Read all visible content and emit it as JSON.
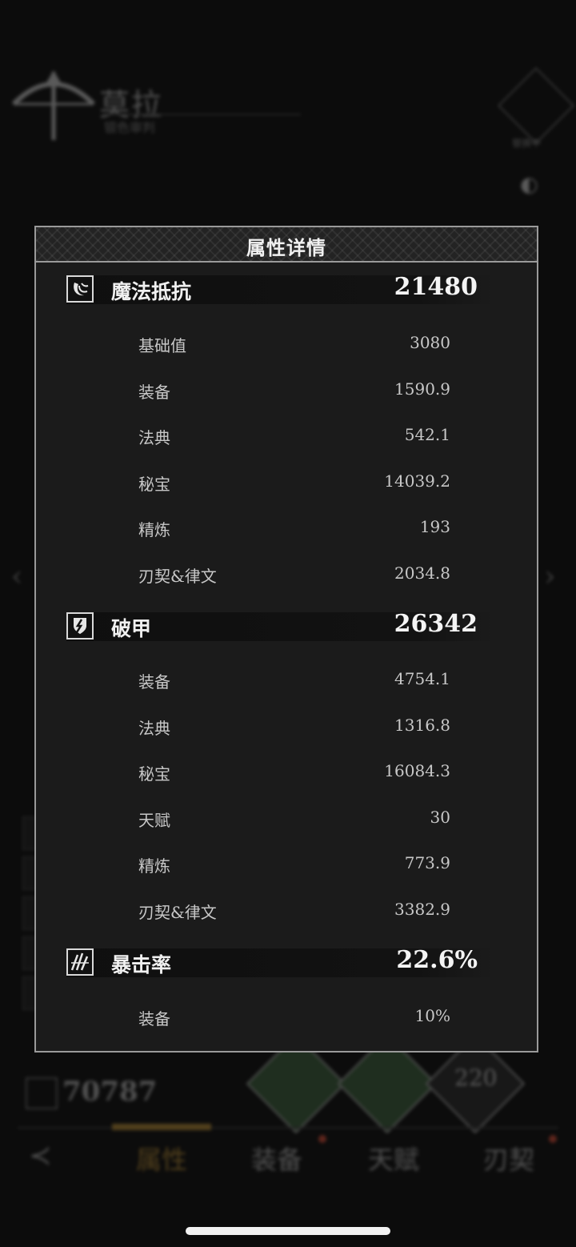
{
  "background": {
    "character_name": "莫拉",
    "character_subtitle": "银色审判",
    "top_right_label": "替换中",
    "power_value": "70787",
    "level_label": "220",
    "tabs": [
      {
        "label": "属性",
        "active": true
      },
      {
        "label": "装备",
        "active": false
      },
      {
        "label": "天赋",
        "active": false
      },
      {
        "label": "刃契",
        "active": false
      }
    ]
  },
  "modal": {
    "title": "属性详情",
    "sections": [
      {
        "icon": "magic-resist-icon",
        "label": "魔法抵抗",
        "value": "21480",
        "rows": [
          {
            "label": "基础值",
            "value": "3080"
          },
          {
            "label": "装备",
            "value": "1590.9"
          },
          {
            "label": "法典",
            "value": "542.1"
          },
          {
            "label": "秘宝",
            "value": "14039.2"
          },
          {
            "label": "精炼",
            "value": "193"
          },
          {
            "label": "刃契&律文",
            "value": "2034.8"
          }
        ]
      },
      {
        "icon": "armor-break-icon",
        "label": "破甲",
        "value": "26342",
        "rows": [
          {
            "label": "装备",
            "value": "4754.1"
          },
          {
            "label": "法典",
            "value": "1316.8"
          },
          {
            "label": "秘宝",
            "value": "16084.3"
          },
          {
            "label": "天赋",
            "value": "30"
          },
          {
            "label": "精炼",
            "value": "773.9"
          },
          {
            "label": "刃契&律文",
            "value": "3382.9"
          }
        ]
      },
      {
        "icon": "crit-rate-icon",
        "label": "暴击率",
        "value": "22.6%",
        "rows": [
          {
            "label": "装备",
            "value": "10%"
          }
        ]
      }
    ]
  },
  "colors": {
    "modal_bg": "#1b1b1b",
    "modal_border": "#9a9a9a",
    "active_tab": "#8a6a2a",
    "text_primary": "#f0f0f0",
    "text_secondary": "#c8c8c8"
  }
}
